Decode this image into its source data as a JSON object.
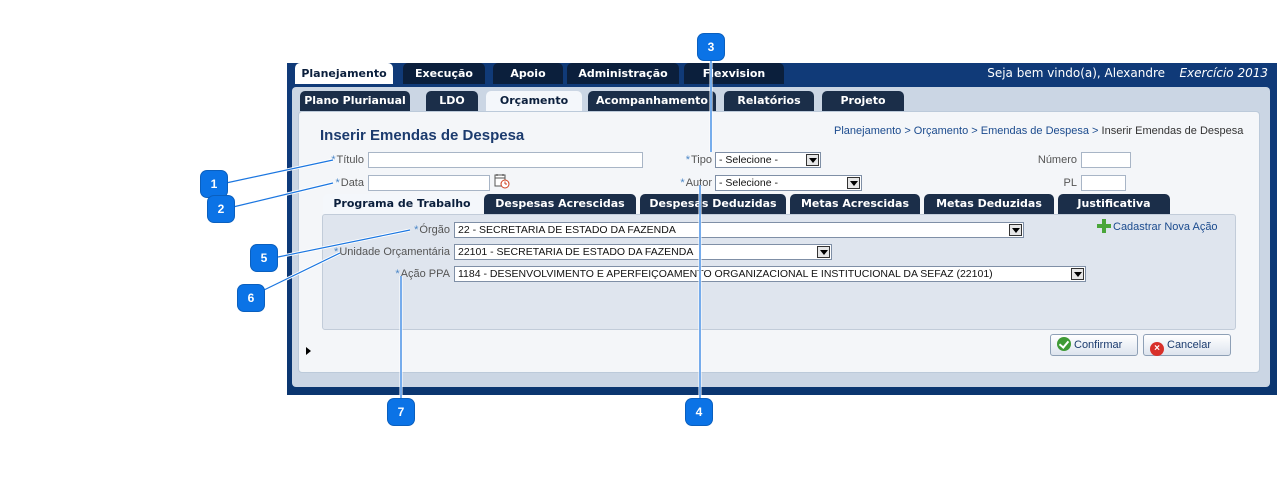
{
  "header": {
    "welcome": "Seja bem vindo(a), Alexandre",
    "exercicio": "Exercício 2013",
    "top_tabs": [
      {
        "label": "Planejamento",
        "active": true
      },
      {
        "label": "Execução",
        "active": false
      },
      {
        "label": "Apoio",
        "active": false
      },
      {
        "label": "Administração",
        "active": false
      },
      {
        "label": "Flexvision",
        "active": false
      }
    ],
    "sub_tabs": [
      {
        "label": "Plano Plurianual",
        "active": false
      },
      {
        "label": "LDO",
        "active": false
      },
      {
        "label": "Orçamento",
        "active": true
      },
      {
        "label": "Acompanhamento",
        "active": false
      },
      {
        "label": "Relatórios",
        "active": false
      },
      {
        "label": "Projeto",
        "active": false
      }
    ]
  },
  "page": {
    "title": "Inserir Emendas de Despesa",
    "breadcrumb": {
      "links": "Planejamento > Orçamento > Emendas de Despesa > ",
      "current": "Inserir Emendas de Despesa"
    }
  },
  "form": {
    "titulo_label": "Título",
    "titulo_value": "",
    "data_label": "Data",
    "data_value": "",
    "tipo_label": "Tipo",
    "tipo_value": "- Selecione -",
    "autor_label": "Autor",
    "autor_value": "- Selecione -",
    "numero_label": "Número",
    "numero_value": "",
    "pl_label": "PL",
    "pl_value": "",
    "required_mark": "*"
  },
  "inner_tabs": [
    {
      "label": "Programa de Trabalho",
      "active": true
    },
    {
      "label": "Despesas Acrescidas",
      "active": false
    },
    {
      "label": "Despesas Deduzidas",
      "active": false
    },
    {
      "label": "Metas Acrescidas",
      "active": false
    },
    {
      "label": "Metas Deduzidas",
      "active": false
    },
    {
      "label": "Justificativa",
      "active": false
    }
  ],
  "programa": {
    "orgao_label": "Órgão",
    "orgao_value": "22 - SECRETARIA DE ESTADO DA FAZENDA",
    "unidade_label": "Unidade Orçamentária",
    "unidade_value": "22101 - SECRETARIA DE ESTADO DA FAZENDA",
    "acao_label": "Ação PPA",
    "acao_value": "1184 - DESENVOLVIMENTO E APERFEIÇOAMENTO ORGANIZACIONAL E INSTITUCIONAL DA SEFAZ (22101)",
    "add_action_label": "Cadastrar Nova Ação"
  },
  "buttons": {
    "confirm": "Confirmar",
    "cancel": "Cancelar"
  },
  "callouts": [
    "1",
    "2",
    "3",
    "4",
    "5",
    "6",
    "7"
  ],
  "colors": {
    "frame": "#0d3a7a",
    "callout": "#0b73e6",
    "tab_dark": "#1b2e49"
  }
}
